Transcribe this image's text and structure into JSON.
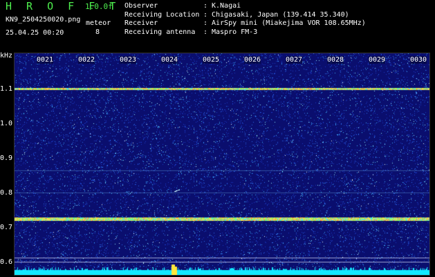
{
  "header": {
    "title": "H R O F F T",
    "version": "1.0.0f",
    "filename": "KN9_2504250020.png",
    "datetime": "25.04.25 00:20",
    "meteor_label": "meteor",
    "meteor_count": "8"
  },
  "info": [
    {
      "key": "Observer",
      "value": "K.Nagai"
    },
    {
      "key": "Receiving Location",
      "value": "Chigasaki, Japan (139.414 35.340)"
    },
    {
      "key": "Receiver",
      "value": "AirSpy mini (Miakejima VOR 108.65MHz)"
    },
    {
      "key": "Receiving antenna",
      "value": "Maspro FM-3"
    }
  ],
  "axis": {
    "unit": "kHz",
    "y_ticks": [
      "1.1",
      "1.0",
      "0.9",
      "0.8",
      "0.7",
      "0.6"
    ],
    "x_ticks": [
      "0021",
      "0022",
      "0023",
      "0024",
      "0025",
      "0026",
      "0027",
      "0028",
      "0029",
      "0030"
    ]
  },
  "colors": {
    "background": "#0a0e6e",
    "band": "#ffd84a",
    "base_strip": "#12e8ff",
    "title_green": "#4ef04e"
  }
}
